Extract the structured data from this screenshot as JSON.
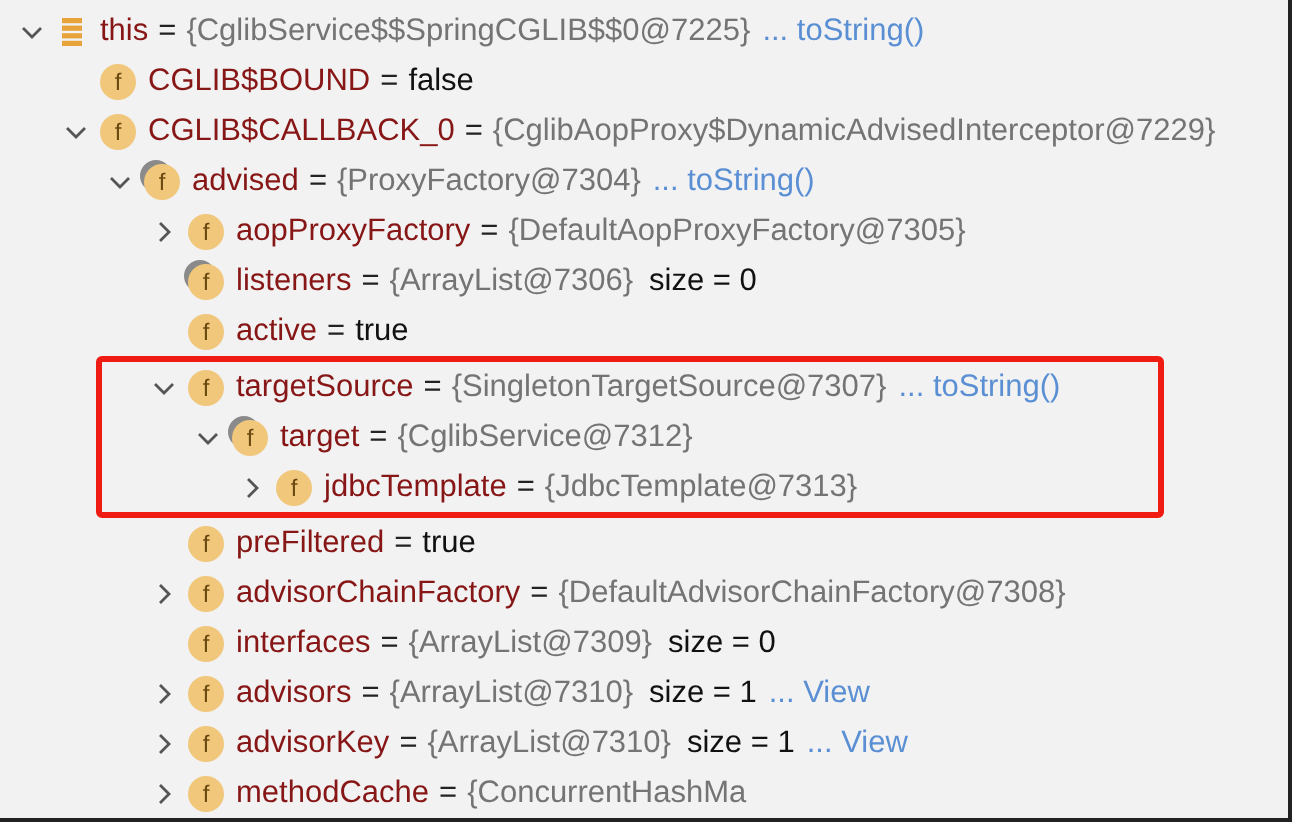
{
  "variables": [
    {
      "kind": "object",
      "name": "this",
      "eq": "=",
      "value": "{CglibService$$SpringCGLIB$$0@7225}",
      "link": "... toString()",
      "expanded": true,
      "highlighted": false,
      "children": [
        {
          "kind": "field",
          "badge": "f",
          "name": "CGLIB$BOUND",
          "eq": "=",
          "value": "false",
          "highlighted": false
        },
        {
          "kind": "field",
          "badge": "f",
          "name": "CGLIB$CALLBACK_0",
          "eq": "=",
          "value": "{CglibAopProxy$DynamicAdvisedInterceptor@7229}",
          "expanded": true,
          "highlighted": false,
          "children": [
            {
              "kind": "final",
              "badge": "f",
              "name": "advised",
              "eq": "=",
              "value": "{ProxyFactory@7304}",
              "link": "... toString()",
              "expanded": true,
              "highlighted": false,
              "children": [
                {
                  "kind": "field",
                  "badge": "f",
                  "name": "aopProxyFactory",
                  "eq": "=",
                  "value": "{DefaultAopProxyFactory@7305}",
                  "expanded": false,
                  "highlighted": false
                },
                {
                  "kind": "final",
                  "badge": "f",
                  "name": "listeners",
                  "eq": "=",
                  "value": "{ArrayList@7306}",
                  "extra": "size = 0",
                  "highlighted": false
                },
                {
                  "kind": "field",
                  "badge": "f",
                  "name": "active",
                  "eq": "=",
                  "value": "true",
                  "highlighted": false
                },
                {
                  "kind": "field",
                  "badge": "f",
                  "name": "targetSource",
                  "eq": "=",
                  "value": "{SingletonTargetSource@7307}",
                  "link": "... toString()",
                  "expanded": true,
                  "highlighted": true,
                  "children": [
                    {
                      "kind": "final",
                      "badge": "f",
                      "name": "target",
                      "eq": "=",
                      "value": "{CglibService@7312}",
                      "expanded": true,
                      "highlighted": false,
                      "children": [
                        {
                          "kind": "field",
                          "badge": "f",
                          "name": "jdbcTemplate",
                          "eq": "=",
                          "value": "{JdbcTemplate@7313}",
                          "expanded": false,
                          "highlighted": false
                        }
                      ]
                    }
                  ]
                },
                {
                  "kind": "field",
                  "badge": "f",
                  "name": "preFiltered",
                  "eq": "=",
                  "value": "true",
                  "highlighted": false
                },
                {
                  "kind": "field",
                  "badge": "f",
                  "name": "advisorChainFactory",
                  "eq": "=",
                  "value": "{DefaultAdvisorChainFactory@7308}",
                  "expanded": false,
                  "highlighted": false
                },
                {
                  "kind": "field",
                  "badge": "f",
                  "name": "interfaces",
                  "eq": "=",
                  "value": "{ArrayList@7309}",
                  "extra": "size = 0",
                  "highlighted": false
                },
                {
                  "kind": "field",
                  "badge": "f",
                  "name": "advisors",
                  "eq": "=",
                  "value": "{ArrayList@7310}",
                  "extra": "size = 1",
                  "link": "... View",
                  "expanded": false,
                  "highlighted": false
                },
                {
                  "kind": "field",
                  "badge": "f",
                  "name": "advisorKey",
                  "eq": "=",
                  "value": "{ArrayList@7310}",
                  "extra": "size = 1",
                  "link": "... View",
                  "expanded": false,
                  "highlighted": false
                },
                {
                  "kind": "field",
                  "badge": "f",
                  "name": "methodCache",
                  "eq": "=",
                  "value": "{ConcurrentHashMa",
                  "expanded": false,
                  "highlighted": false
                }
              ]
            }
          ]
        }
      ]
    }
  ]
}
